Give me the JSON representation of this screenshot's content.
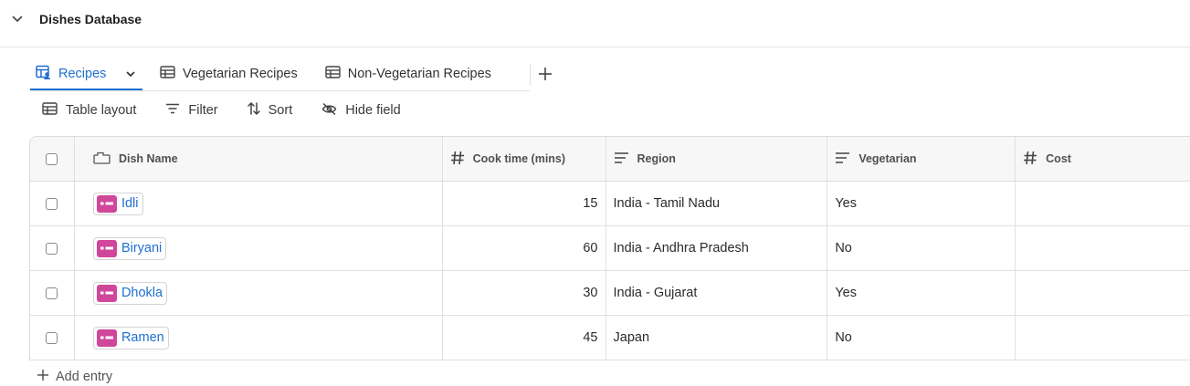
{
  "database": {
    "title": "Dishes Database"
  },
  "tabs": [
    {
      "label": "Recipes",
      "active": true
    },
    {
      "label": "Vegetarian Recipes",
      "active": false
    },
    {
      "label": "Non-Vegetarian Recipes",
      "active": false
    }
  ],
  "toolbar": {
    "table_layout": "Table layout",
    "filter": "Filter",
    "sort": "Sort",
    "hide_field": "Hide field"
  },
  "table": {
    "columns": {
      "name": "Dish Name",
      "cook": "Cook time (mins)",
      "region": "Region",
      "veg": "Vegetarian",
      "cost": "Cost"
    },
    "rows": [
      {
        "name": "Idli",
        "cook": "15",
        "region": "India - Tamil Nadu",
        "veg": "Yes",
        "cost": ""
      },
      {
        "name": "Biryani",
        "cook": "60",
        "region": "India - Andhra Pradesh",
        "veg": "No",
        "cost": ""
      },
      {
        "name": "Dhokla",
        "cook": "30",
        "region": "India - Gujarat",
        "veg": "Yes",
        "cost": ""
      },
      {
        "name": "Ramen",
        "cook": "45",
        "region": "Japan",
        "veg": "No",
        "cost": ""
      }
    ]
  },
  "footer": {
    "add_entry": "Add entry"
  },
  "colors": {
    "accent": "#1f6fd1",
    "chip_icon": "#d0469a"
  },
  "icons": {
    "collapse": "chevron-down-icon",
    "recipes_tab": "table-user-icon",
    "tab_dropdown": "chevron-down-icon",
    "other_tabs": "table-icon",
    "add_view": "plus-icon",
    "filter": "filter-lines-icon",
    "sort": "sort-arrows-icon",
    "hide": "eye-off-icon",
    "name_column": "tag-icon",
    "number_column": "hash-icon",
    "text_column": "text-lines-icon"
  }
}
